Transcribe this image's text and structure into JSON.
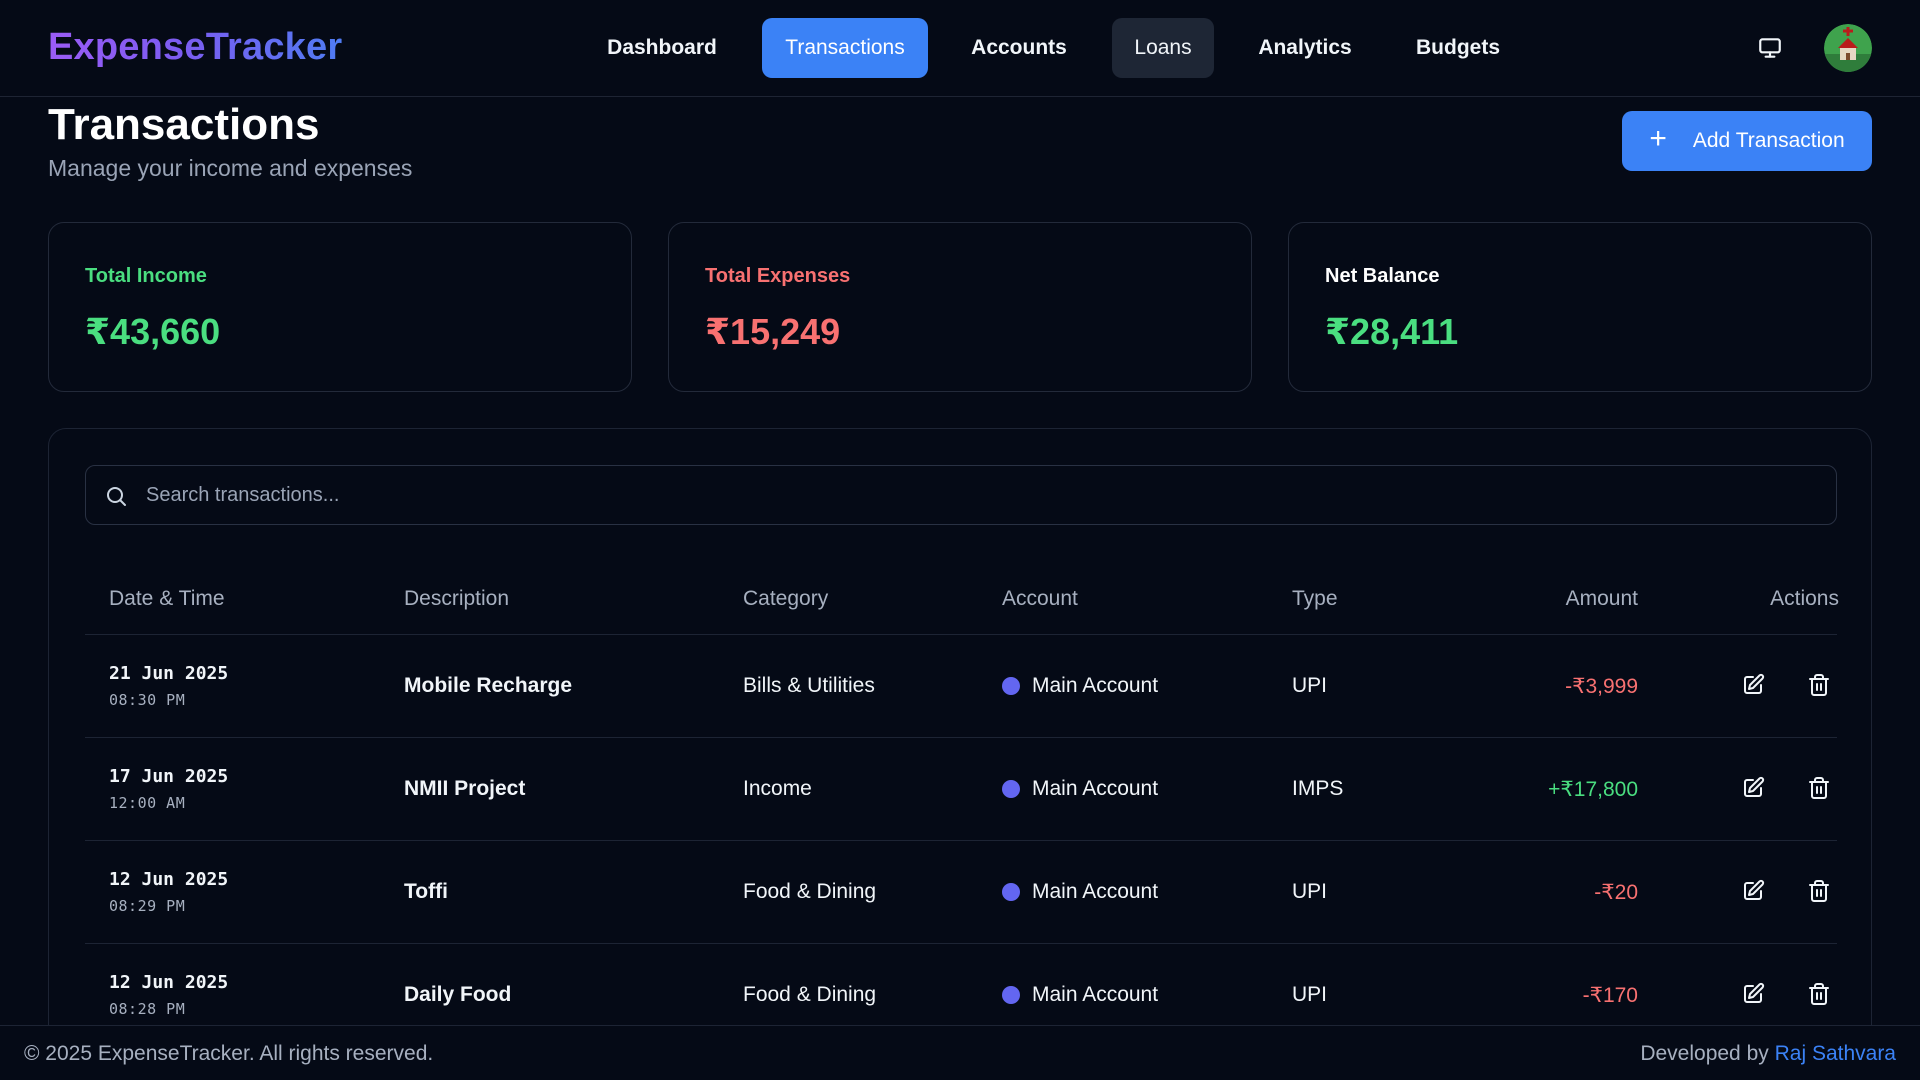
{
  "app": {
    "logo": "ExpenseTracker"
  },
  "nav": {
    "items": [
      {
        "label": "Dashboard"
      },
      {
        "label": "Transactions"
      },
      {
        "label": "Accounts"
      },
      {
        "label": "Loans"
      },
      {
        "label": "Analytics"
      },
      {
        "label": "Budgets"
      }
    ],
    "active": "Transactions",
    "hovered": "Loans",
    "right_icons": [
      "monitor-icon",
      "user-avatar"
    ]
  },
  "header": {
    "title": "Transactions",
    "subtitle": "Manage your income and expenses",
    "add_button": "Add Transaction"
  },
  "stats": [
    {
      "label": "Total Income",
      "value": "₹43,660",
      "color": "#4ade80"
    },
    {
      "label": "Total Expenses",
      "value": "₹15,249",
      "color": "#f87171"
    },
    {
      "label": "Net Balance",
      "value": "₹28,411",
      "color": "#4ade80"
    }
  ],
  "search": {
    "placeholder": "Search transactions..."
  },
  "table": {
    "columns": [
      "Date & Time",
      "Description",
      "Category",
      "Account",
      "Type",
      "Amount",
      "Actions"
    ],
    "rows": [
      {
        "date": "21 Jun 2025",
        "time": "08:30 PM",
        "description": "Mobile Recharge",
        "category": "Bills & Utilities",
        "account": "Main Account",
        "type": "UPI",
        "amount": "-₹3,999",
        "direction": "expense"
      },
      {
        "date": "17 Jun 2025",
        "time": "12:00 AM",
        "description": "NMII Project",
        "category": "Income",
        "account": "Main Account",
        "type": "IMPS",
        "amount": "+₹17,800",
        "direction": "income"
      },
      {
        "date": "12 Jun 2025",
        "time": "08:29 PM",
        "description": "Toffi",
        "category": "Food & Dining",
        "account": "Main Account",
        "type": "UPI",
        "amount": "-₹20",
        "direction": "expense"
      },
      {
        "date": "12 Jun 2025",
        "time": "08:28 PM",
        "description": "Daily Food",
        "category": "Food & Dining",
        "account": "Main Account",
        "type": "UPI",
        "amount": "-₹170",
        "direction": "expense"
      }
    ],
    "action_icons": [
      "edit-icon",
      "trash-icon"
    ]
  },
  "colors": {
    "accent": "#3b82f6",
    "income": "#4ade80",
    "expense": "#f87171",
    "account_dot": "#6366f1"
  },
  "footer": {
    "copyright": "© 2025 ExpenseTracker. All rights reserved.",
    "developed_by": "Developed by",
    "developer": "Raj Sathvara"
  }
}
